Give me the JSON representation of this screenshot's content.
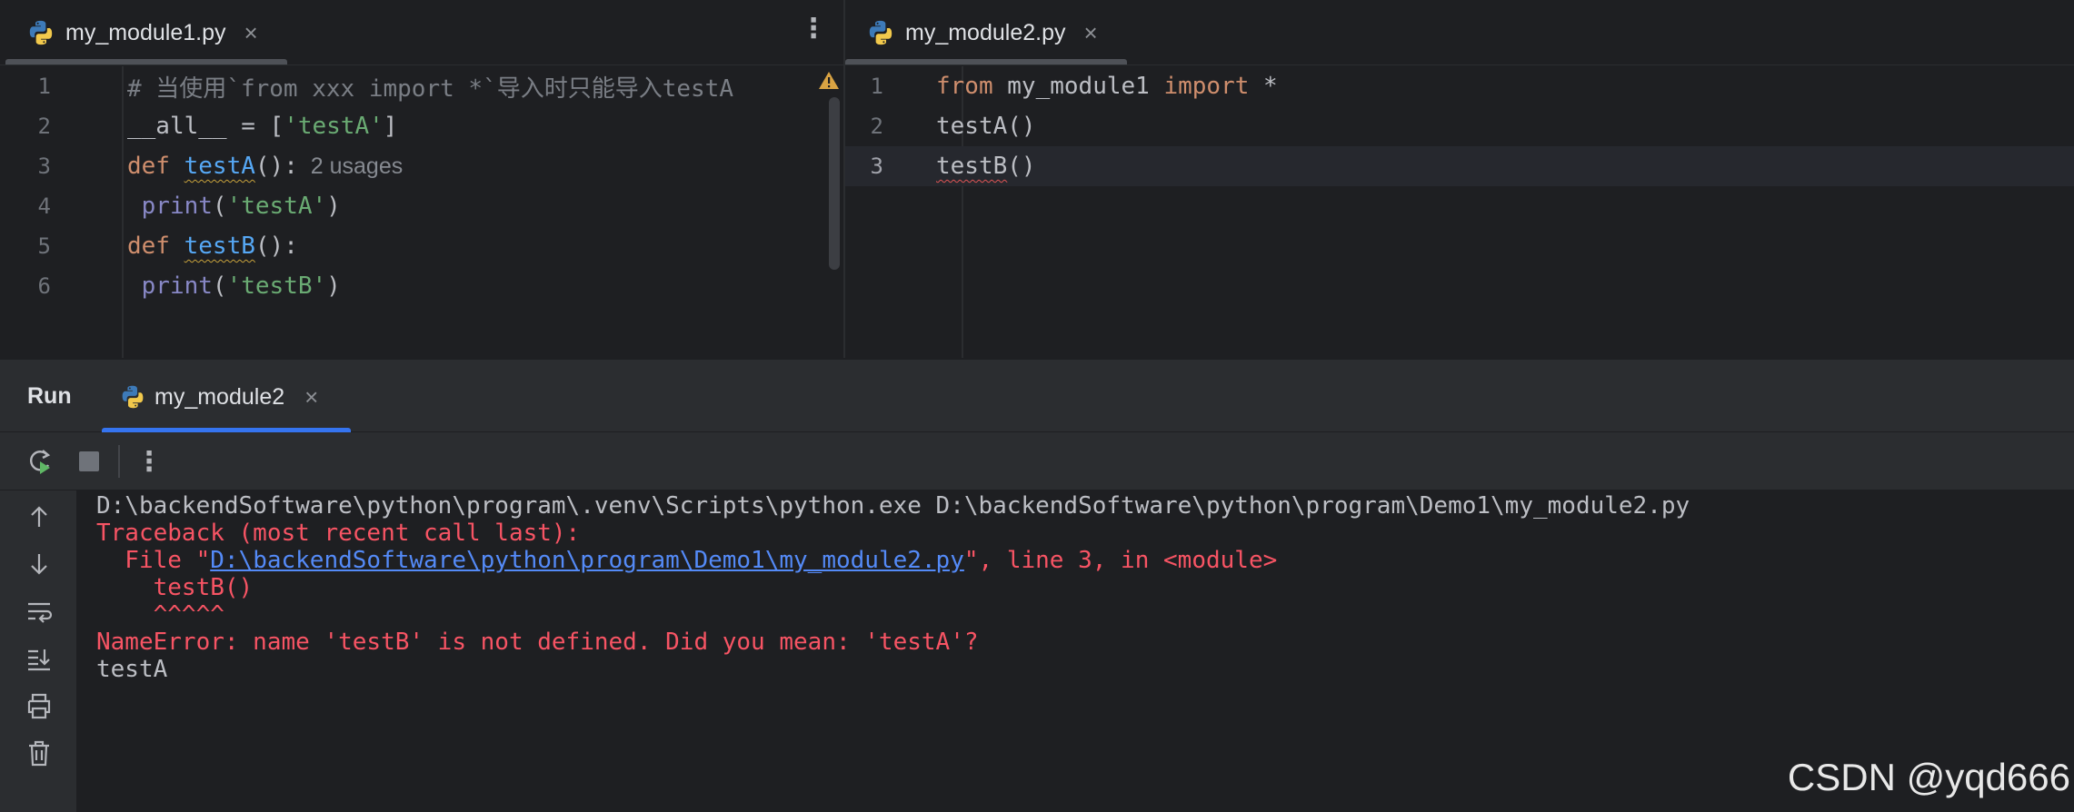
{
  "colors": {
    "editor_bg": "#1e1f22",
    "panel_bg": "#2b2d30",
    "keyword": "#cf8e6d",
    "string": "#6aab73",
    "function": "#56a8f5",
    "builtin": "#8888c6",
    "comment": "#7a7e85",
    "error": "#f75464",
    "link": "#548af7",
    "accent": "#3574f0"
  },
  "left_editor": {
    "tab": {
      "icon": "python-file-icon",
      "label": "my_module1.py",
      "close": "×"
    },
    "menu": "⋮",
    "lines": [
      {
        "num": "1",
        "parts": [
          {
            "t": "# 当使用`from xxx import *`导入时只能导入testA",
            "c": "c-comment"
          }
        ]
      },
      {
        "num": "2",
        "parts": [
          {
            "t": "__all__ = [",
            "c": "c-plain"
          },
          {
            "t": "'testA'",
            "c": "c-str"
          },
          {
            "t": "]",
            "c": "c-plain"
          }
        ]
      },
      {
        "num": "3",
        "parts": [
          {
            "t": "def ",
            "c": "c-kw"
          },
          {
            "t": "testA",
            "c": "c-fn sq-warn"
          },
          {
            "t": "():",
            "c": "c-plain"
          },
          {
            "t": "  2 usages",
            "c": "c-hint"
          }
        ]
      },
      {
        "num": "4",
        "parts": [
          {
            "t": " print",
            "c": "c-builtin"
          },
          {
            "t": "(",
            "c": "c-plain"
          },
          {
            "t": "'testA'",
            "c": "c-str"
          },
          {
            "t": ")",
            "c": "c-plain"
          }
        ]
      },
      {
        "num": "5",
        "parts": [
          {
            "t": "def ",
            "c": "c-kw"
          },
          {
            "t": "testB",
            "c": "c-fn sq-warn"
          },
          {
            "t": "():",
            "c": "c-plain"
          }
        ]
      },
      {
        "num": "6",
        "parts": [
          {
            "t": " print",
            "c": "c-builtin"
          },
          {
            "t": "(",
            "c": "c-plain"
          },
          {
            "t": "'testB'",
            "c": "c-str"
          },
          {
            "t": ")",
            "c": "c-plain"
          }
        ]
      }
    ]
  },
  "right_editor": {
    "tab": {
      "icon": "python-file-icon",
      "label": "my_module2.py",
      "close": "×"
    },
    "current_line": 3,
    "lines": [
      {
        "num": "1",
        "parts": [
          {
            "t": "from ",
            "c": "c-kw"
          },
          {
            "t": "my_module1 ",
            "c": "c-plain"
          },
          {
            "t": "import ",
            "c": "c-kw"
          },
          {
            "t": "*",
            "c": "c-plain"
          }
        ]
      },
      {
        "num": "2",
        "parts": [
          {
            "t": "testA()",
            "c": "c-plain"
          }
        ]
      },
      {
        "num": "3",
        "parts": [
          {
            "t": "testB",
            "c": "c-plain sq-err"
          },
          {
            "t": "()",
            "c": "c-plain"
          }
        ]
      }
    ]
  },
  "run_window": {
    "title": "Run",
    "tab": {
      "icon": "python-run-icon",
      "label": "my_module2",
      "close": "×"
    },
    "toolbar": [
      {
        "name": "rerun-icon"
      },
      {
        "name": "stop-icon"
      },
      {
        "name": "more-options-icon",
        "glyph": "⋮"
      }
    ],
    "rail": [
      {
        "name": "scroll-up-icon"
      },
      {
        "name": "scroll-down-icon"
      },
      {
        "name": "soft-wrap-icon"
      },
      {
        "name": "scroll-to-end-icon"
      },
      {
        "name": "print-icon"
      },
      {
        "name": "clear-all-icon"
      }
    ],
    "output": [
      {
        "parts": [
          {
            "t": "D:\\backendSoftware\\python\\program\\.venv\\Scripts\\python.exe D:\\backendSoftware\\python\\program\\Demo1\\my_module2.py",
            "c": "o-plain"
          }
        ]
      },
      {
        "parts": [
          {
            "t": "Traceback (most recent call last):",
            "c": "o-err"
          }
        ]
      },
      {
        "parts": [
          {
            "t": "  File \"",
            "c": "o-err"
          },
          {
            "t": "D:\\backendSoftware\\python\\program\\Demo1\\my_module2.py",
            "c": "o-link",
            "link": true
          },
          {
            "t": "\", line 3, in <module>",
            "c": "o-err"
          }
        ]
      },
      {
        "parts": [
          {
            "t": "    testB()",
            "c": "o-err"
          }
        ]
      },
      {
        "parts": [
          {
            "t": "    ^^^^^",
            "c": "o-err"
          }
        ]
      },
      {
        "parts": [
          {
            "t": "NameError: name 'testB' is not defined. Did you mean: 'testA'?",
            "c": "o-err"
          }
        ]
      },
      {
        "parts": [
          {
            "t": "testA",
            "c": "o-plain"
          }
        ]
      }
    ]
  },
  "watermark": "CSDN @yqd666"
}
